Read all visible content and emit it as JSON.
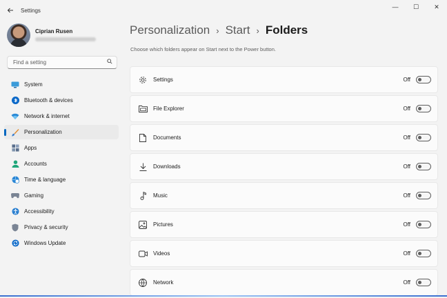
{
  "window": {
    "title": "Settings",
    "controls": {
      "minimize": "—",
      "maximize": "☐",
      "close": "✕"
    }
  },
  "user": {
    "name": "Ciprian Rusen"
  },
  "search": {
    "placeholder": "Find a setting"
  },
  "nav": {
    "items": [
      {
        "label": "System",
        "icon": "monitor-icon",
        "selected": false
      },
      {
        "label": "Bluetooth & devices",
        "icon": "bluetooth-icon",
        "selected": false
      },
      {
        "label": "Network & internet",
        "icon": "wifi-icon",
        "selected": false
      },
      {
        "label": "Personalization",
        "icon": "brush-icon",
        "selected": true
      },
      {
        "label": "Apps",
        "icon": "apps-icon",
        "selected": false
      },
      {
        "label": "Accounts",
        "icon": "person-icon",
        "selected": false
      },
      {
        "label": "Time & language",
        "icon": "globe-clock-icon",
        "selected": false
      },
      {
        "label": "Gaming",
        "icon": "gamepad-icon",
        "selected": false
      },
      {
        "label": "Accessibility",
        "icon": "accessibility-icon",
        "selected": false
      },
      {
        "label": "Privacy & security",
        "icon": "shield-icon",
        "selected": false
      },
      {
        "label": "Windows Update",
        "icon": "update-icon",
        "selected": false
      }
    ]
  },
  "breadcrumb": [
    "Personalization",
    "Start",
    "Folders"
  ],
  "breadcrumb_separator": "›",
  "subtitle": "Choose which folders appear on Start next to the Power button.",
  "folders": [
    {
      "label": "Settings",
      "icon": "gear-icon",
      "state": "Off",
      "on": false
    },
    {
      "label": "File Explorer",
      "icon": "file-explorer-icon",
      "state": "Off",
      "on": false
    },
    {
      "label": "Documents",
      "icon": "document-icon",
      "state": "Off",
      "on": false
    },
    {
      "label": "Downloads",
      "icon": "download-icon",
      "state": "Off",
      "on": false
    },
    {
      "label": "Music",
      "icon": "music-icon",
      "state": "Off",
      "on": false
    },
    {
      "label": "Pictures",
      "icon": "picture-icon",
      "state": "Off",
      "on": false
    },
    {
      "label": "Videos",
      "icon": "video-icon",
      "state": "Off",
      "on": false
    },
    {
      "label": "Network",
      "icon": "network-icon",
      "state": "Off",
      "on": false
    }
  ],
  "colors": {
    "accent": "#0067c0",
    "background": "#f3f3f3",
    "card": "#fbfbfb"
  }
}
